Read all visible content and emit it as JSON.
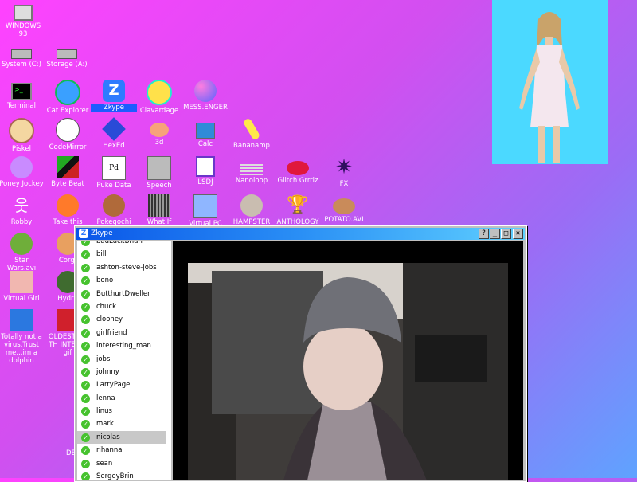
{
  "desktop_icons": [
    {
      "label": "WINDOWS 93",
      "icon": "computer-icon"
    },
    {
      "label": "System (C:)",
      "icon": "disk-icon"
    },
    {
      "label": "Storage (A:)",
      "icon": "floppy-icon"
    },
    {
      "label": "Terminal",
      "icon": "terminal-icon"
    },
    {
      "label": "Cat Explorer",
      "icon": "globe-icon"
    },
    {
      "label": "Zkype",
      "icon": "zkype-icon"
    },
    {
      "label": "Clavardage",
      "icon": "chat-bubble-icon"
    },
    {
      "label": "MESS.ENGER",
      "icon": "messenger-icon"
    },
    {
      "label": "Piskel",
      "icon": "palette-icon"
    },
    {
      "label": "CodeMirror",
      "icon": "codemirror-icon"
    },
    {
      "label": "HexEd",
      "icon": "hexagon-icon"
    },
    {
      "label": "3d",
      "icon": "teapot-icon"
    },
    {
      "label": "Calc",
      "icon": "calculator-icon"
    },
    {
      "label": "Bananamp",
      "icon": "banana-icon"
    },
    {
      "label": "Poney Jockey",
      "icon": "pony-icon"
    },
    {
      "label": "Byte Beat",
      "icon": "bytebeat-icon"
    },
    {
      "label": "Puke Data",
      "icon": "puke-data-icon"
    },
    {
      "label": "Speech",
      "icon": "face-icon"
    },
    {
      "label": "LSDJ",
      "icon": "gameboy-icon"
    },
    {
      "label": "Nanoloop",
      "icon": "nanoloop-icon"
    },
    {
      "label": "Glitch Grrrlz",
      "icon": "lips-icon"
    },
    {
      "label": "FX",
      "icon": "star-burst-icon"
    },
    {
      "label": "Robby",
      "icon": "stick-figure-icon"
    },
    {
      "label": "Take this",
      "icon": "take-this-icon"
    },
    {
      "label": "Pokegochi",
      "icon": "pokegochi-icon"
    },
    {
      "label": "What If",
      "icon": "what-if-icon"
    },
    {
      "label": "Virtual PC",
      "icon": "virtual-pc-icon"
    },
    {
      "label": "HAMPSTER",
      "icon": "hamster-icon"
    },
    {
      "label": "ANTHOLOGY",
      "icon": "trophy-icon"
    },
    {
      "label": "POTATO.AVI",
      "icon": "potato-icon"
    },
    {
      "label": "Star Wars.avi",
      "icon": "yoda-icon"
    },
    {
      "label": "Corgi",
      "icon": "corgi-icon"
    },
    {
      "label": "Virtual Girl",
      "icon": "girl-face-icon"
    },
    {
      "label": "Hydra",
      "icon": "hydra-icon"
    },
    {
      "label": "Totally not a virus.Trust me...im a dolphin",
      "icon": "dolphin-icon"
    },
    {
      "label": "OLDEST OF TH INTERW gif",
      "icon": "gif-icon"
    },
    {
      "label": "DE",
      "icon": "partial-icon"
    }
  ],
  "zkype": {
    "title": "Zkype",
    "help_btn": "?",
    "min_btn": "_",
    "max_btn": "□",
    "close_btn": "✕",
    "contacts": [
      "badLuckBrian",
      "bill",
      "ashton-steve-jobs",
      "bono",
      "ButthurtDweller",
      "chuck",
      "clooney",
      "girlfriend",
      "interesting_man",
      "jobs",
      "johnny",
      "LarryPage",
      "lenna",
      "linus",
      "mark",
      "nicolas",
      "rihanna",
      "sean",
      "SergeyBrin"
    ],
    "selected_contact": "nicolas",
    "check_glyph": "✓"
  },
  "colors": {
    "desktop_start": "#ff42ff",
    "desktop_end": "#5fa3ff",
    "titlebar": "#0a56e8",
    "selected_icon": "#1d5cff",
    "online_green": "#46c22e"
  }
}
